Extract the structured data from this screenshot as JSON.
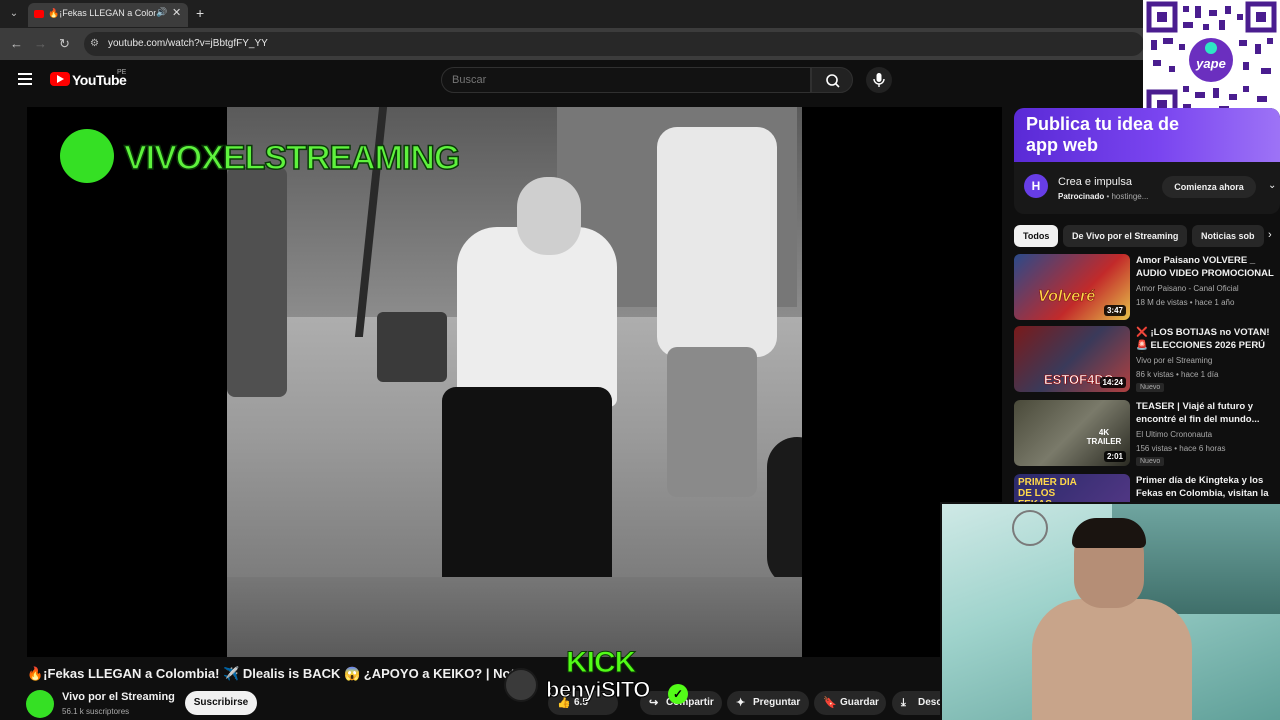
{
  "browser": {
    "tab_title": "🔥¡Fekas LLEGAN a Colombia",
    "url": "youtube.com/watch?v=jBbtgfFY_YY"
  },
  "header": {
    "logo_text": "YouTube",
    "country_code": "PE",
    "search_placeholder": "Buscar"
  },
  "player": {
    "watermark_text": "VIVOXELSTREAMING"
  },
  "video": {
    "title": "🔥¡Fekas LLEGAN a Colombia! ✈️ Dlealis is BACK 😱 ¿APOYO a KEIKO? | Not",
    "channel_name": "Vivo por el Streaming",
    "subscribers": "56.1 k suscriptores",
    "subscribe_label": "Suscribirse",
    "actions": [
      {
        "label": "Compartir",
        "icon": "share-icon"
      },
      {
        "label": "Preguntar",
        "icon": "sparkle-icon"
      },
      {
        "label": "Guardar",
        "icon": "bookmark-icon"
      },
      {
        "label": "Desc",
        "icon": "download-icon"
      }
    ],
    "like_count": "6.5"
  },
  "kick_overlay": {
    "logo": "KICK",
    "username": "benyiSITO"
  },
  "ad": {
    "headline": "Publica tu idea de app web",
    "title": "Crea e impulsa",
    "sponsored_label": "Patrocinado",
    "advertiser": "hostinge...",
    "cta": "Comienza ahora",
    "brand_color": "#673de6"
  },
  "chips": [
    "Todos",
    "De Vivo por el Streaming",
    "Noticias sob"
  ],
  "recommendations": [
    {
      "title": "Amor Paisano VOLVERE _ AUDIO VIDEO PROMOCIONAL ...",
      "channel": "Amor Paisano - Canal Oficial",
      "meta": "18 M de vistas • hace 1 año",
      "duration": "3:47",
      "badge": "",
      "thumb_text": "Volveré"
    },
    {
      "title": "❌ ¡LOS BOTIJAS no VOTAN! 🚨 ELECCIONES 2026 PERÚ 😂 | ...",
      "channel": "Vivo por el Streaming",
      "meta": "86 k vistas • hace 1 día",
      "duration": "14:24",
      "badge": "Nuevo",
      "thumb_text": "ESTOF4DO"
    },
    {
      "title": "TEASER | Viajé al futuro y encontré el fin del mundo...",
      "channel": "El Ultimo Crononauta",
      "meta": "156 vistas • hace 6 horas",
      "duration": "2:01",
      "badge": "Nuevo",
      "thumb_text": "4K TRAILER"
    },
    {
      "title": "Primer día de Kingteka y los Fekas en Colombia, visitan la ...",
      "channel": "",
      "meta": "",
      "duration": "",
      "badge": "",
      "thumb_text": "PRIMER DIA DE LOS FEKAS"
    }
  ],
  "colors": {
    "background": "#0f0f0f",
    "youtube_red": "#ff0000",
    "kick_green": "#53fc18"
  }
}
